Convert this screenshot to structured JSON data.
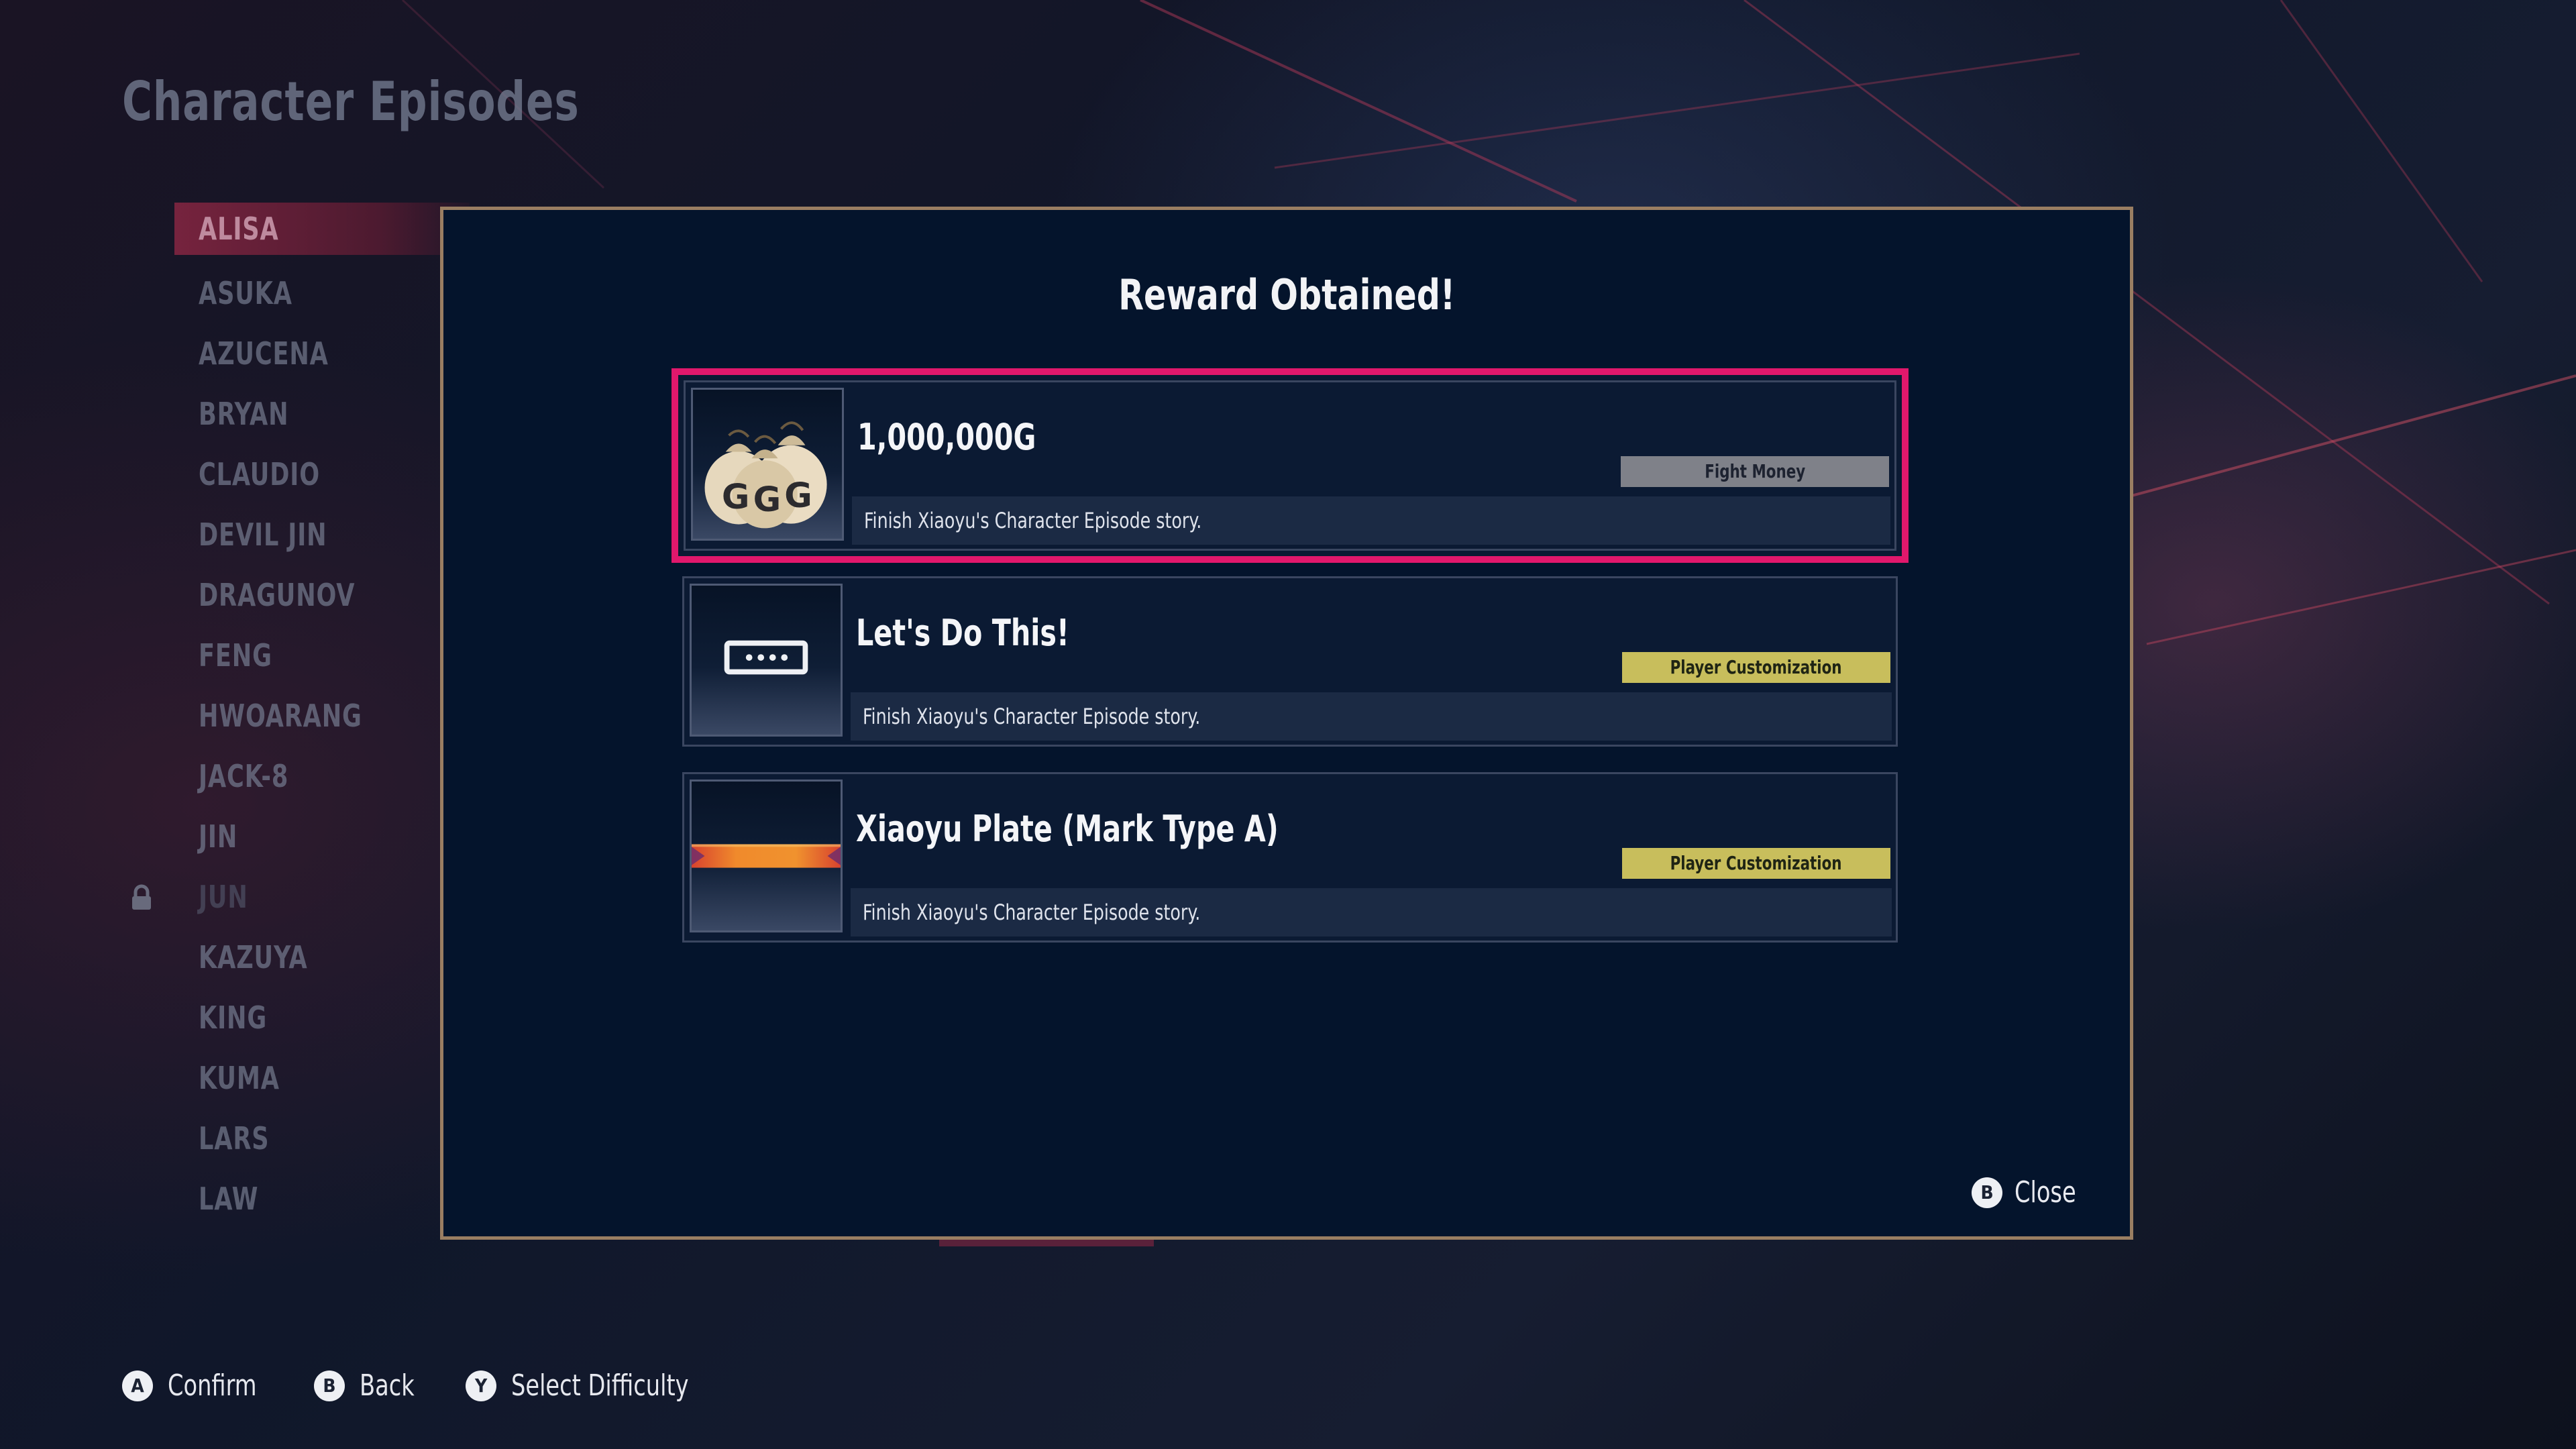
{
  "screen": {
    "title": "Character Episodes"
  },
  "characters": [
    {
      "name": "ALISA",
      "selected": true,
      "locked": false
    },
    {
      "name": "ASUKA",
      "selected": false,
      "locked": false
    },
    {
      "name": "AZUCENA",
      "selected": false,
      "locked": false
    },
    {
      "name": "BRYAN",
      "selected": false,
      "locked": false
    },
    {
      "name": "CLAUDIO",
      "selected": false,
      "locked": false
    },
    {
      "name": "DEVIL JIN",
      "selected": false,
      "locked": false
    },
    {
      "name": "DRAGUNOV",
      "selected": false,
      "locked": false
    },
    {
      "name": "FENG",
      "selected": false,
      "locked": false
    },
    {
      "name": "HWOARANG",
      "selected": false,
      "locked": false
    },
    {
      "name": "JACK-8",
      "selected": false,
      "locked": false
    },
    {
      "name": "JIN",
      "selected": false,
      "locked": false
    },
    {
      "name": "JUN",
      "selected": false,
      "locked": true
    },
    {
      "name": "KAZUYA",
      "selected": false,
      "locked": false
    },
    {
      "name": "KING",
      "selected": false,
      "locked": false
    },
    {
      "name": "KUMA",
      "selected": false,
      "locked": false
    },
    {
      "name": "LARS",
      "selected": false,
      "locked": false
    },
    {
      "name": "LAW",
      "selected": false,
      "locked": false
    }
  ],
  "modal": {
    "title": "Reward Obtained!",
    "rewards": [
      {
        "name": "1,000,000G",
        "category": "Fight Money",
        "description": "Finish Xiaoyu's Character Episode story.",
        "icon": "money-bags-icon",
        "focused": true
      },
      {
        "name": "Let's Do This!",
        "category": "Player Customization",
        "description": "Finish Xiaoyu's Character Episode story.",
        "icon": "speech-message-icon",
        "focused": false
      },
      {
        "name": "Xiaoyu Plate (Mark Type A)",
        "category": "Player Customization",
        "description": "Finish Xiaoyu's Character Episode story.",
        "icon": "name-plate-icon",
        "focused": false
      }
    ],
    "close": {
      "glyph": "B",
      "label": "Close"
    }
  },
  "footer": {
    "hints": [
      {
        "glyph": "A",
        "label": "Confirm"
      },
      {
        "glyph": "B",
        "label": "Back"
      },
      {
        "glyph": "Y",
        "label": "Select Difficulty"
      }
    ]
  },
  "colors": {
    "focus_border": "#e1186c",
    "modal_border": "#9a7e62",
    "modal_bg": "#04142c",
    "tag_fight_money": "#7f8189",
    "tag_player_customization": "#c8be5c"
  }
}
